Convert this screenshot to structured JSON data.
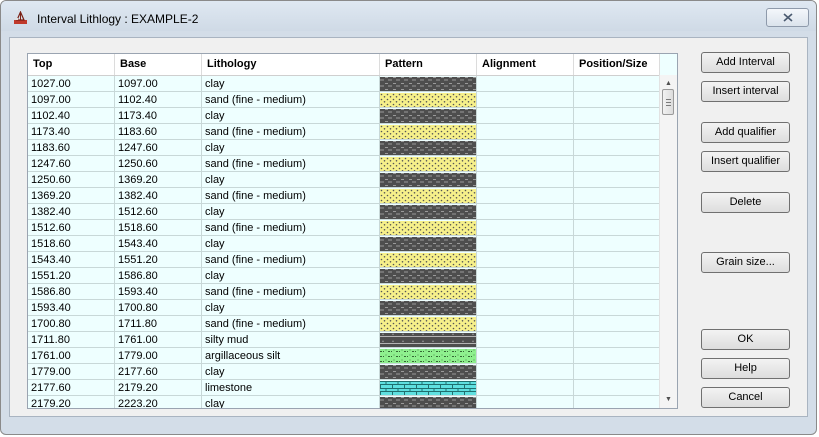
{
  "window": {
    "title": "Interval Lithlogy : EXAMPLE-2"
  },
  "table": {
    "columns": [
      "Top",
      "Base",
      "Lithology",
      "Pattern",
      "Alignment",
      "Position/Size"
    ],
    "rows": [
      {
        "top": "1027.00",
        "base": "1097.00",
        "lithology": "clay",
        "pattern": "clay"
      },
      {
        "top": "1097.00",
        "base": "1102.40",
        "lithology": "sand (fine - medium)",
        "pattern": "sand"
      },
      {
        "top": "1102.40",
        "base": "1173.40",
        "lithology": "clay",
        "pattern": "clay"
      },
      {
        "top": "1173.40",
        "base": "1183.60",
        "lithology": "sand (fine - medium)",
        "pattern": "sand"
      },
      {
        "top": "1183.60",
        "base": "1247.60",
        "lithology": "clay",
        "pattern": "clay"
      },
      {
        "top": "1247.60",
        "base": "1250.60",
        "lithology": "sand (fine - medium)",
        "pattern": "sand"
      },
      {
        "top": "1250.60",
        "base": "1369.20",
        "lithology": "clay",
        "pattern": "clay"
      },
      {
        "top": "1369.20",
        "base": "1382.40",
        "lithology": "sand (fine - medium)",
        "pattern": "sand"
      },
      {
        "top": "1382.40",
        "base": "1512.60",
        "lithology": "clay",
        "pattern": "clay"
      },
      {
        "top": "1512.60",
        "base": "1518.60",
        "lithology": "sand (fine - medium)",
        "pattern": "sand"
      },
      {
        "top": "1518.60",
        "base": "1543.40",
        "lithology": "clay",
        "pattern": "clay"
      },
      {
        "top": "1543.40",
        "base": "1551.20",
        "lithology": "sand (fine - medium)",
        "pattern": "sand"
      },
      {
        "top": "1551.20",
        "base": "1586.80",
        "lithology": "clay",
        "pattern": "clay"
      },
      {
        "top": "1586.80",
        "base": "1593.40",
        "lithology": "sand (fine - medium)",
        "pattern": "sand"
      },
      {
        "top": "1593.40",
        "base": "1700.80",
        "lithology": "clay",
        "pattern": "clay"
      },
      {
        "top": "1700.80",
        "base": "1711.80",
        "lithology": "sand (fine - medium)",
        "pattern": "sand"
      },
      {
        "top": "1711.80",
        "base": "1761.00",
        "lithology": "silty mud",
        "pattern": "silty-mud"
      },
      {
        "top": "1761.00",
        "base": "1779.00",
        "lithology": "argillaceous silt",
        "pattern": "argillaceous-silt"
      },
      {
        "top": "1779.00",
        "base": "2177.60",
        "lithology": "clay",
        "pattern": "clay"
      },
      {
        "top": "2177.60",
        "base": "2179.20",
        "lithology": "limestone",
        "pattern": "limestone"
      },
      {
        "top": "2179.20",
        "base": "2223.20",
        "lithology": "clay",
        "pattern": "clay"
      }
    ]
  },
  "buttons": {
    "add_interval": "Add Interval",
    "insert_interval": "Insert interval",
    "add_qualifier": "Add qualifier",
    "insert_qualifier": "Insert qualifier",
    "delete": "Delete",
    "grain_size": "Grain size...",
    "ok": "OK",
    "help": "Help",
    "cancel": "Cancel"
  },
  "icons": {
    "app": "rig-icon",
    "close": "close-icon",
    "scroll_up": "scroll-up-arrow-icon",
    "scroll_down": "scroll-down-arrow-icon"
  },
  "colors": {
    "grid_background": "#eeffff",
    "clay": "#4e4e4e",
    "sand": "#f6f08a",
    "silty_mud": "#4e4e4e",
    "argillaceous_silt": "#8ef08e",
    "limestone": "#5fe0e0"
  }
}
